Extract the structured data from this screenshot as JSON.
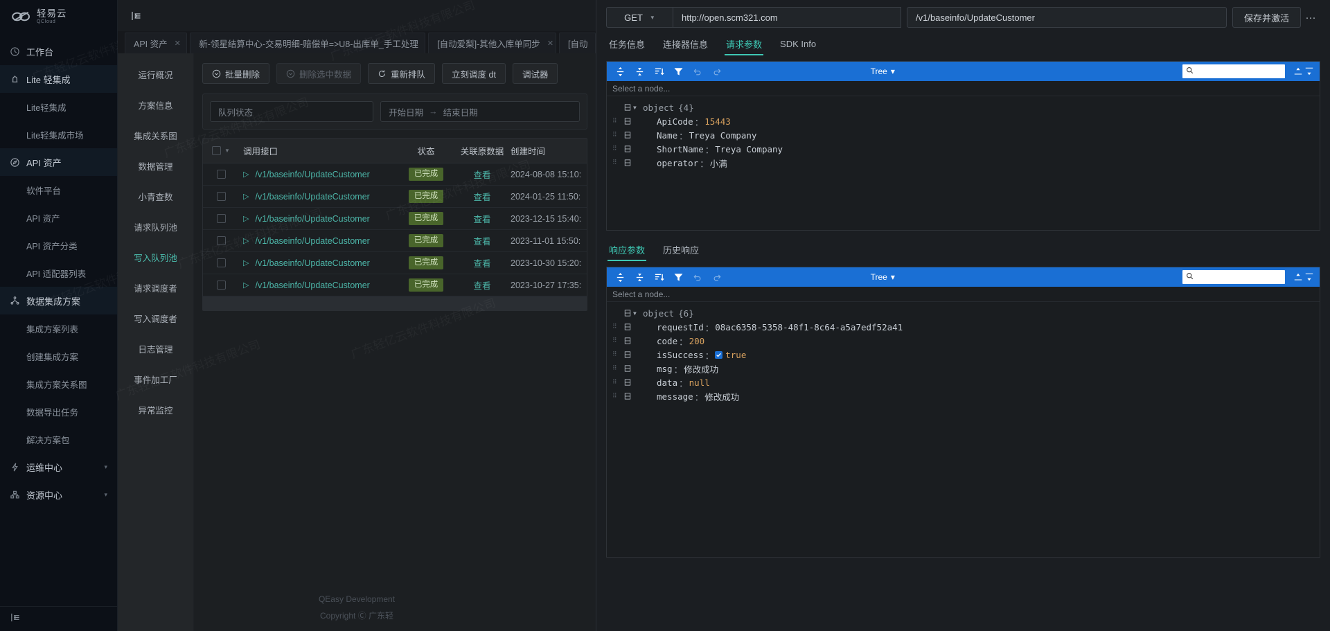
{
  "brand": {
    "name_cn": "轻易云",
    "name_en": "QCloud"
  },
  "sidebar": {
    "items": [
      {
        "label": "工作台",
        "icon": "clock-icon",
        "type": "group"
      },
      {
        "label": "Lite 轻集成",
        "icon": "lite-icon",
        "type": "group",
        "active": true
      },
      {
        "label": "Lite轻集成",
        "type": "sub"
      },
      {
        "label": "Lite轻集成市场",
        "type": "sub"
      },
      {
        "label": "API 资产",
        "icon": "compass-icon",
        "type": "group",
        "active": true
      },
      {
        "label": "软件平台",
        "type": "sub"
      },
      {
        "label": "API 资产",
        "type": "sub"
      },
      {
        "label": "API 资产分类",
        "type": "sub"
      },
      {
        "label": "API 适配器列表",
        "type": "sub"
      },
      {
        "label": "数据集成方案",
        "icon": "sitemap-icon",
        "type": "group",
        "active": true
      },
      {
        "label": "集成方案列表",
        "type": "sub"
      },
      {
        "label": "创建集成方案",
        "type": "sub"
      },
      {
        "label": "集成方案关系图",
        "type": "sub"
      },
      {
        "label": "数据导出任务",
        "type": "sub"
      },
      {
        "label": "解决方案包",
        "type": "sub"
      },
      {
        "label": "运维中心",
        "icon": "bolt-icon",
        "type": "group",
        "caret": true
      },
      {
        "label": "资源中心",
        "icon": "resource-icon",
        "type": "group",
        "caret": true
      }
    ]
  },
  "tabs": [
    {
      "label": "API 资产",
      "closable": true
    },
    {
      "label": "新-领星结算中心-交易明细-赔偿单=>U8-出库单_手工处理",
      "closable": true
    },
    {
      "label": "[自动爱梨]-其他入库单同步",
      "closable": true
    },
    {
      "label": "[自动",
      "closable": false
    }
  ],
  "subnav": {
    "items": [
      {
        "label": "运行概况"
      },
      {
        "label": "方案信息"
      },
      {
        "label": "集成关系图"
      },
      {
        "label": "数据管理"
      },
      {
        "label": "小青查数"
      },
      {
        "label": "请求队列池"
      },
      {
        "label": "写入队列池",
        "active": true
      },
      {
        "label": "请求调度者"
      },
      {
        "label": "写入调度者"
      },
      {
        "label": "日志管理"
      },
      {
        "label": "事件加工厂"
      },
      {
        "label": "异常监控"
      }
    ]
  },
  "toolbar": {
    "buttons": [
      {
        "label": "批量删除",
        "icon": "circle-chevron-icon",
        "disabled": false
      },
      {
        "label": "删除选中数据",
        "icon": "circle-chevron-icon",
        "disabled": true
      },
      {
        "label": "重新排队",
        "icon": "refresh-icon",
        "disabled": false
      },
      {
        "label": "立刻调度 dt",
        "icon": "none",
        "disabled": false
      },
      {
        "label": "调试器",
        "icon": "none",
        "disabled": false
      }
    ]
  },
  "filters": {
    "status_placeholder": "队列状态",
    "start_date_placeholder": "开始日期",
    "range_arrow": "→",
    "end_date_placeholder": "结束日期"
  },
  "table": {
    "columns": [
      "调用接口",
      "状态",
      "关联原数据",
      "创建时间"
    ],
    "rows": [
      {
        "api": "/v1/baseinfo/UpdateCustomer",
        "status": "已完成",
        "relation": "查看",
        "time": "2024-08-08 15:10:"
      },
      {
        "api": "/v1/baseinfo/UpdateCustomer",
        "status": "已完成",
        "relation": "查看",
        "time": "2024-01-25 11:50:"
      },
      {
        "api": "/v1/baseinfo/UpdateCustomer",
        "status": "已完成",
        "relation": "查看",
        "time": "2023-12-15 15:40:"
      },
      {
        "api": "/v1/baseinfo/UpdateCustomer",
        "status": "已完成",
        "relation": "查看",
        "time": "2023-11-01 15:50:"
      },
      {
        "api": "/v1/baseinfo/UpdateCustomer",
        "status": "已完成",
        "relation": "查看",
        "time": "2023-10-30 15:20:"
      },
      {
        "api": "/v1/baseinfo/UpdateCustomer",
        "status": "已完成",
        "relation": "查看",
        "time": "2023-10-27 17:35:"
      }
    ]
  },
  "footer": {
    "line1": "QEasy Development",
    "line2": "Copyright Ⓒ 广东轻"
  },
  "request": {
    "method": "GET",
    "host": "http://open.scm321.com",
    "path": "/v1/baseinfo/UpdateCustomer",
    "save_label": "保存并激活",
    "more_label": "···"
  },
  "panel_tabs": [
    {
      "label": "任务信息",
      "active": false
    },
    {
      "label": "连接器信息",
      "active": false
    },
    {
      "label": "请求参数",
      "active": true
    },
    {
      "label": "SDK Info",
      "active": false
    }
  ],
  "request_editor": {
    "mode_label": "Tree",
    "node_placeholder": "Select a node...",
    "search_placeholder": "",
    "root_label": "object",
    "root_count": "{4}",
    "entries": [
      {
        "key": "ApiCode",
        "value": "15443",
        "vtype": "num"
      },
      {
        "key": "Name",
        "value": "Treya Company",
        "vtype": "str"
      },
      {
        "key": "ShortName",
        "value": "Treya Company",
        "vtype": "str"
      },
      {
        "key": "operator",
        "value": "小满",
        "vtype": "str"
      }
    ]
  },
  "response_tabs": [
    {
      "label": "响应参数",
      "active": true
    },
    {
      "label": "历史响应",
      "active": false
    }
  ],
  "response_editor": {
    "mode_label": "Tree",
    "node_placeholder": "Select a node...",
    "root_label": "object",
    "root_count": "{6}",
    "entries": [
      {
        "key": "requestId",
        "value": "08ac6358-5358-48f1-8c64-a5a7edf52a41",
        "vtype": "str"
      },
      {
        "key": "code",
        "value": "200",
        "vtype": "num"
      },
      {
        "key": "isSuccess",
        "value": "true",
        "vtype": "bool"
      },
      {
        "key": "msg",
        "value": "修改成功",
        "vtype": "str"
      },
      {
        "key": "data",
        "value": "null",
        "vtype": "null"
      },
      {
        "key": "message",
        "value": "修改成功",
        "vtype": "str"
      }
    ]
  },
  "colors": {
    "accent_teal": "#3ec8b4",
    "editor_menu_blue": "#1a6fd4",
    "status_green": "#49652b",
    "value_orange": "#d9a25f"
  },
  "watermark": {
    "text": "广东轻亿云软件科技有限公司"
  }
}
